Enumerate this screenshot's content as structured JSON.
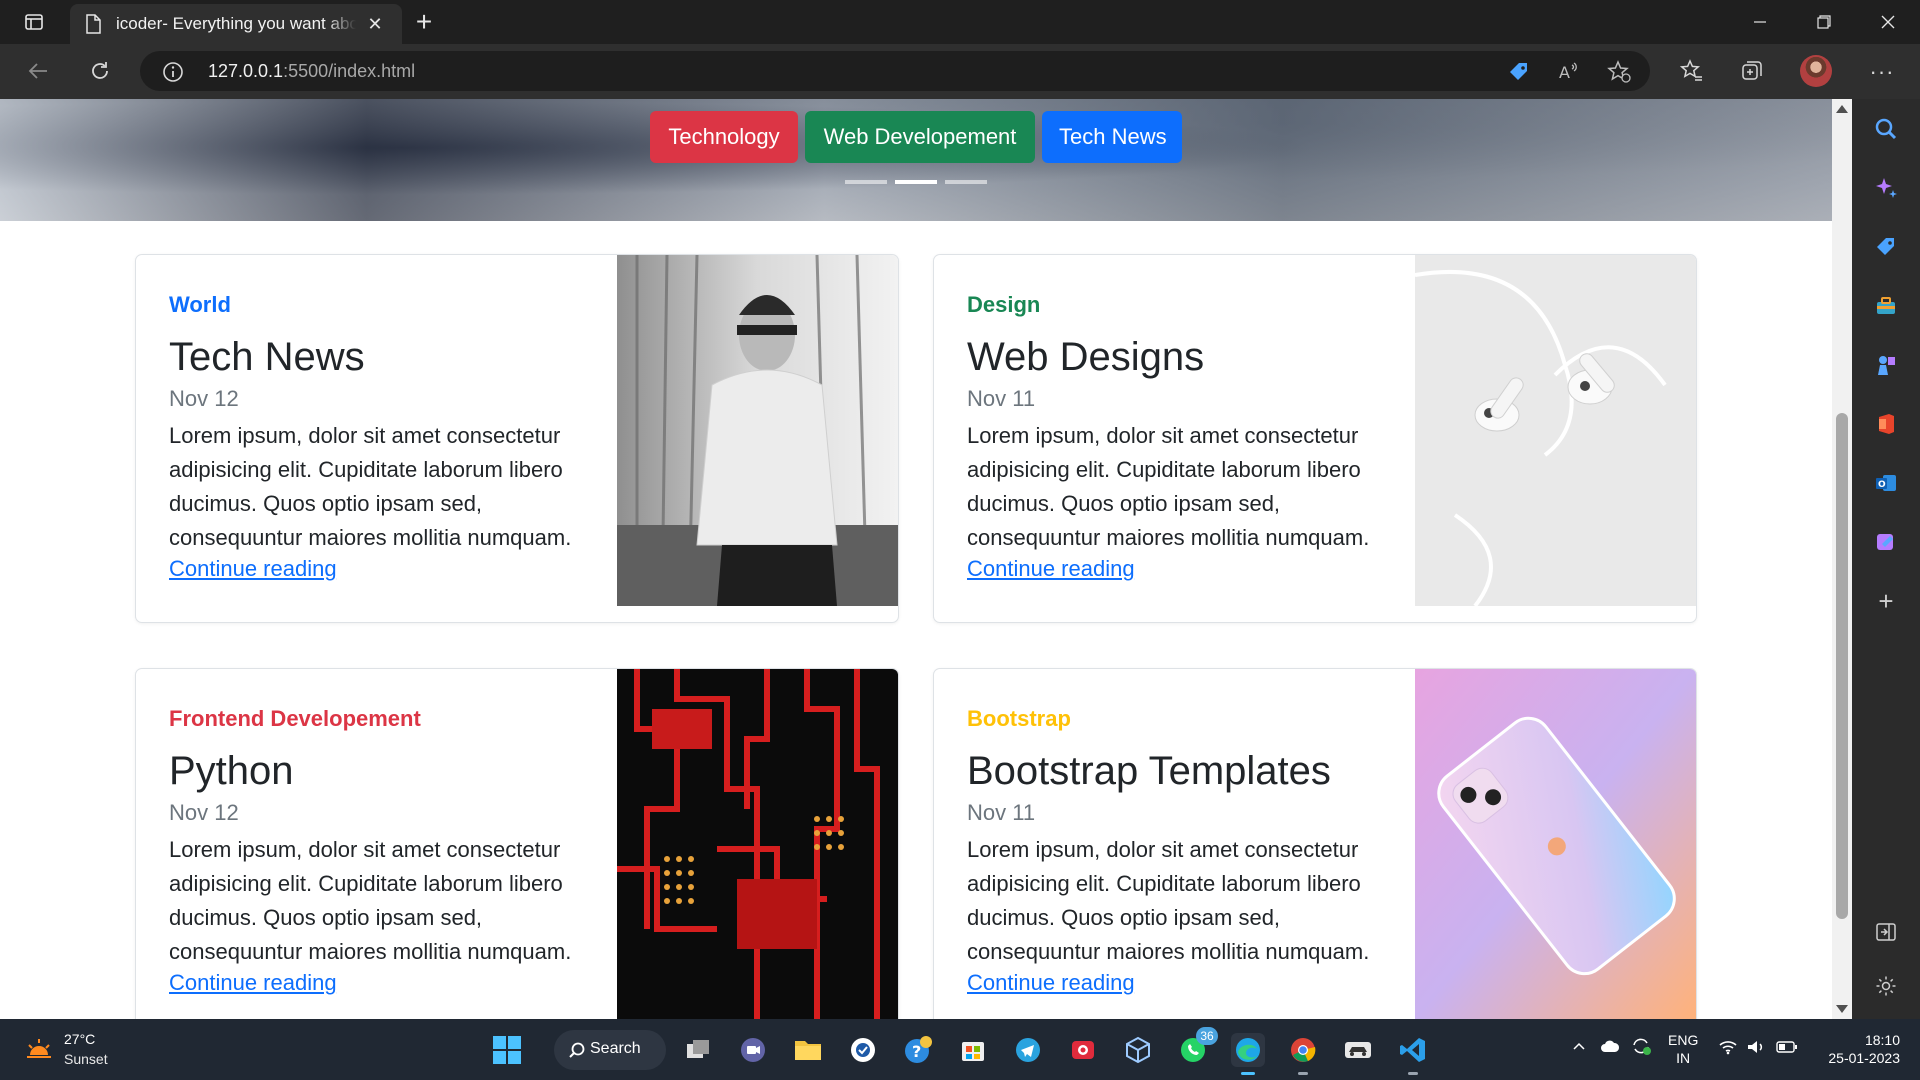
{
  "browser": {
    "tab_title": "icoder- Everything you want abo",
    "url_host": "127.0.0.1",
    "url_path": ":5500/index.html"
  },
  "hero": {
    "buttons": [
      {
        "label": "Technology",
        "color": "#dc3545"
      },
      {
        "label": "Web Developement",
        "color": "#198754"
      },
      {
        "label": "Tech News",
        "color": "#0d6efd"
      }
    ],
    "indicators": 3,
    "active_indicator": 1
  },
  "cards": [
    {
      "category": "World",
      "category_color": "#0d6efd",
      "title": "Tech News",
      "date": "Nov 12",
      "text": "Lorem ipsum, dolor sit amet consectetur adipisicing elit. Cupiditate laborum libero ducimus. Quos optio ipsam sed, consequuntur maiores mollitia numquam.",
      "link": "Continue reading"
    },
    {
      "category": "Design",
      "category_color": "#198754",
      "title": "Web Designs",
      "date": "Nov 11",
      "text": "Lorem ipsum, dolor sit amet consectetur adipisicing elit. Cupiditate laborum libero ducimus. Quos optio ipsam sed, consequuntur maiores mollitia numquam.",
      "link": "Continue reading"
    },
    {
      "category": "Frontend Developement",
      "category_color": "#dc3545",
      "title": "Python",
      "date": "Nov 12",
      "text": "Lorem ipsum, dolor sit amet consectetur adipisicing elit. Cupiditate laborum libero ducimus. Quos optio ipsam sed, consequuntur maiores mollitia numquam.",
      "link": "Continue reading"
    },
    {
      "category": "Bootstrap",
      "category_color": "#ffc107",
      "title": "Bootstrap Templates",
      "date": "Nov 11",
      "text": "Lorem ipsum, dolor sit amet consectetur adipisicing elit. Cupiditate laborum libero ducimus. Quos optio ipsam sed, consequuntur maiores mollitia numquam.",
      "link": "Continue reading"
    }
  ],
  "taskbar": {
    "weather_temp": "27°C",
    "weather_desc": "Sunset",
    "search_label": "Search",
    "whatsapp_badge": "36",
    "lang_line1": "ENG",
    "lang_line2": "IN",
    "time": "18:10",
    "date": "25-01-2023"
  }
}
